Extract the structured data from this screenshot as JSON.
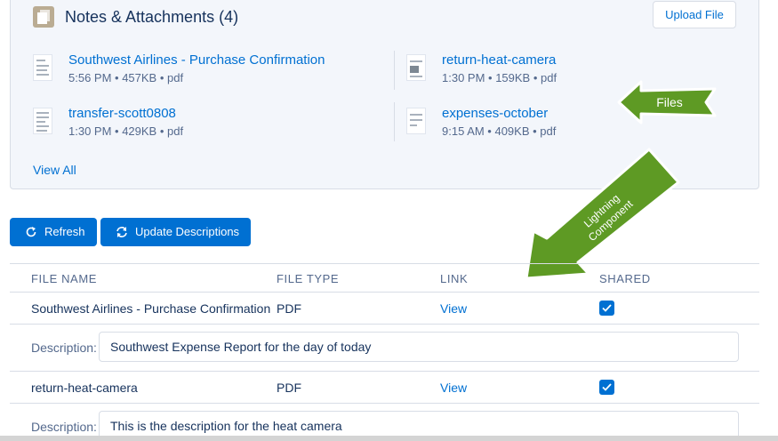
{
  "card": {
    "title": "Notes & Attachments (4)",
    "upload_label": "Upload File",
    "view_all": "View All",
    "files": [
      {
        "name": "Southwest Airlines - Purchase Confirmation",
        "meta": "5:56 PM • 457KB • pdf"
      },
      {
        "name": "return-heat-camera",
        "meta": "1:30 PM • 159KB • pdf"
      },
      {
        "name": "transfer-scott0808",
        "meta": "1:30 PM • 429KB • pdf"
      },
      {
        "name": "expenses-october",
        "meta": "9:15 AM • 409KB • pdf"
      }
    ]
  },
  "annotations": {
    "files_label": "Files",
    "component_line1": "Lightning",
    "component_line2": "Component",
    "arrow_color": "#5e9a24"
  },
  "toolbar": {
    "refresh_label": "Refresh",
    "update_label": "Update Descriptions"
  },
  "table": {
    "headers": {
      "file_name": "FILE NAME",
      "file_type": "FILE TYPE",
      "link": "LINK",
      "shared": "SHARED"
    },
    "description_label": "Description:",
    "rows": [
      {
        "file_name": "Southwest Airlines - Purchase Confirmation",
        "file_type": "PDF",
        "link": "View",
        "shared": true,
        "description": "Southwest Expense Report for the day of today"
      },
      {
        "file_name": "return-heat-camera",
        "file_type": "PDF",
        "link": "View",
        "shared": true,
        "description": "This is the description for the heat camera"
      }
    ]
  },
  "colors": {
    "brand": "#0070d2",
    "text": "#16325c",
    "muted": "#54698d"
  }
}
